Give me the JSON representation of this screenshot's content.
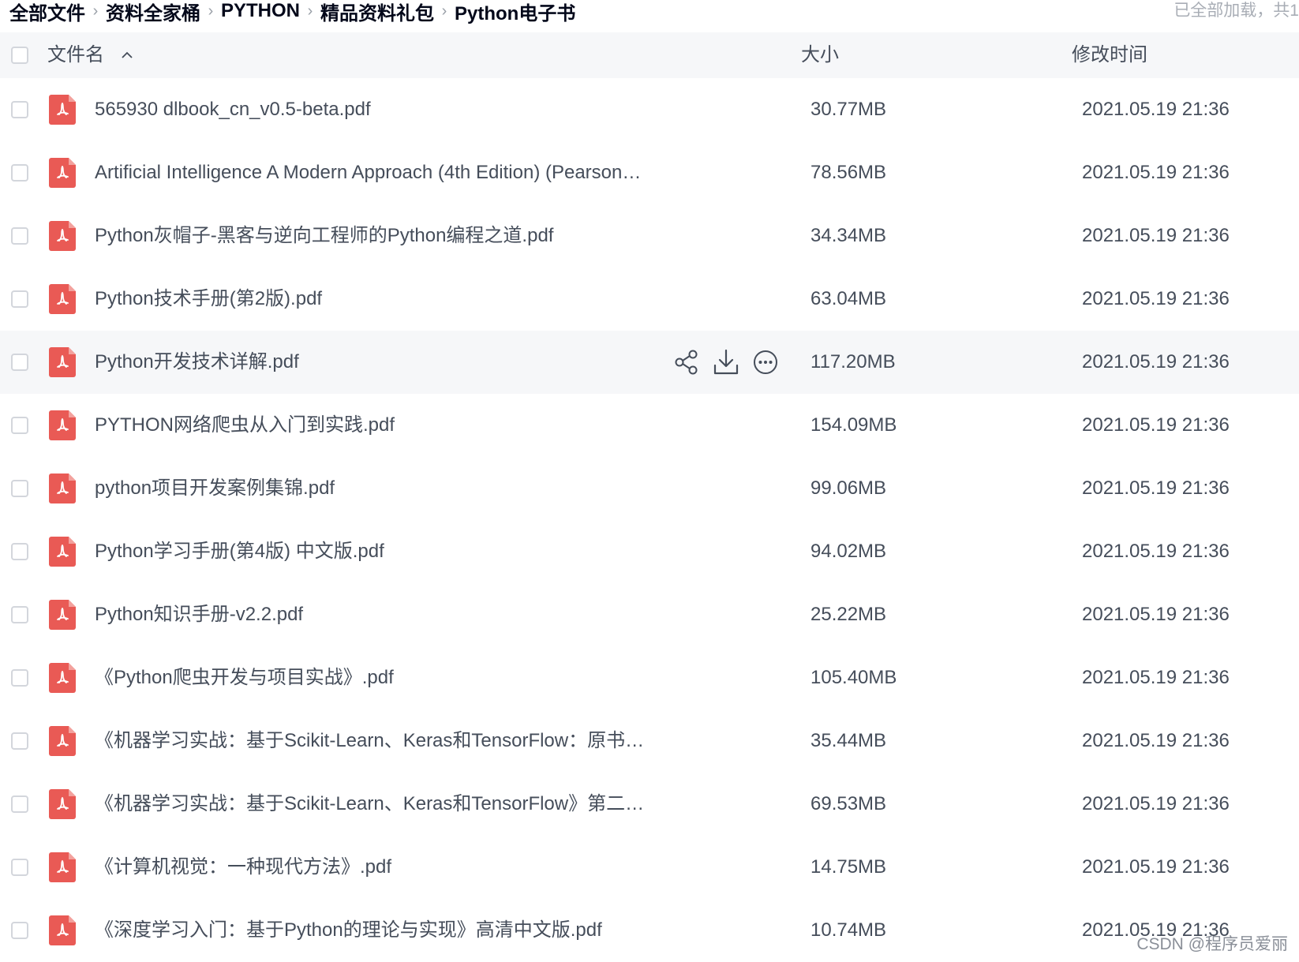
{
  "breadcrumb": {
    "items": [
      "全部文件",
      "资料全家桶",
      "PYTHON",
      "精品资料礼包",
      "Python电子书"
    ],
    "separator": "›"
  },
  "load_status": "已全部加载，共1",
  "header": {
    "name_label": "文件名",
    "size_label": "大小",
    "time_label": "修改时间",
    "sort_icon": "chevron-up-icon"
  },
  "files": [
    {
      "name": "565930 dlbook_cn_v0.5-beta.pdf",
      "size": "30.77MB",
      "time": "2021.05.19 21:36"
    },
    {
      "name": "Artificial Intelligence A Modern Approach (4th Edition) (Pearson…",
      "size": "78.56MB",
      "time": "2021.05.19 21:36"
    },
    {
      "name": "Python灰帽子-黑客与逆向工程师的Python编程之道.pdf",
      "size": "34.34MB",
      "time": "2021.05.19 21:36"
    },
    {
      "name": "Python技术手册(第2版).pdf",
      "size": "63.04MB",
      "time": "2021.05.19 21:36"
    },
    {
      "name": "Python开发技术详解.pdf",
      "size": "117.20MB",
      "time": "2021.05.19 21:36",
      "hover": true
    },
    {
      "name": "PYTHON网络爬虫从入门到实践.pdf",
      "size": "154.09MB",
      "time": "2021.05.19 21:36"
    },
    {
      "name": "python项目开发案例集锦.pdf",
      "size": "99.06MB",
      "time": "2021.05.19 21:36"
    },
    {
      "name": "Python学习手册(第4版) 中文版.pdf",
      "size": "94.02MB",
      "time": "2021.05.19 21:36"
    },
    {
      "name": "Python知识手册-v2.2.pdf",
      "size": "25.22MB",
      "time": "2021.05.19 21:36"
    },
    {
      "name": "《Python爬虫开发与项目实战》.pdf",
      "size": "105.40MB",
      "time": "2021.05.19 21:36"
    },
    {
      "name": "《机器学习实战：基于Scikit-Learn、Keras和TensorFlow：原书…",
      "size": "35.44MB",
      "time": "2021.05.19 21:36"
    },
    {
      "name": "《机器学习实战：基于Scikit-Learn、Keras和TensorFlow》第二…",
      "size": "69.53MB",
      "time": "2021.05.19 21:36"
    },
    {
      "name": "《计算机视觉：一种现代方法》.pdf",
      "size": "14.75MB",
      "time": "2021.05.19 21:36"
    },
    {
      "name": "《深度学习入门：基于Python的理论与实现》高清中文版.pdf",
      "size": "10.74MB",
      "time": "2021.05.19 21:36"
    }
  ],
  "row_icons": {
    "file": "pdf-file-icon",
    "share": "share-icon",
    "download": "download-icon",
    "more": "more-icon"
  },
  "colors": {
    "pdf_icon": "#e95a55",
    "header_bg": "#f6f7f9",
    "hover_bg": "#f6f7f9",
    "text": "#454d5a",
    "breadcrumb": "#03081a"
  },
  "watermark": "CSDN @程序员爱丽"
}
